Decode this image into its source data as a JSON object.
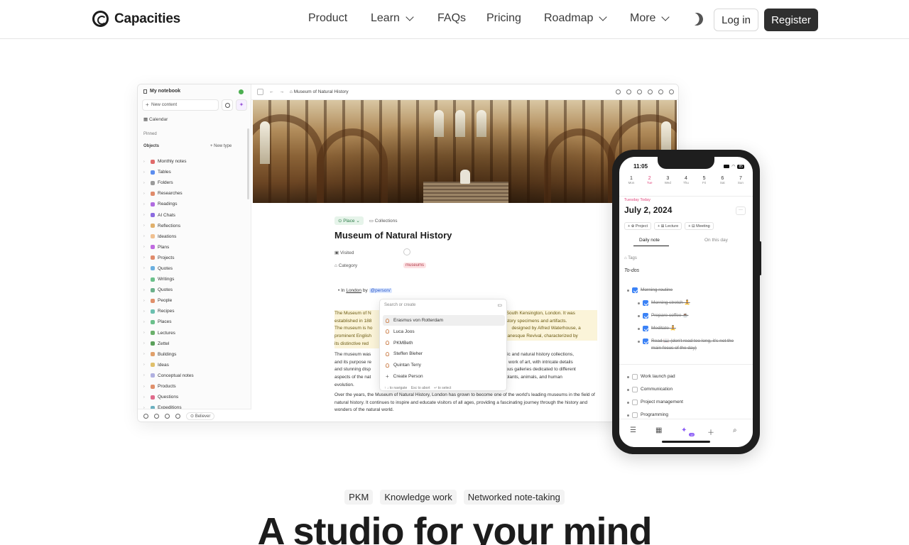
{
  "nav": {
    "brand": "Capacities",
    "items": [
      {
        "label": "Product",
        "dropdown": false
      },
      {
        "label": "Learn",
        "dropdown": true
      },
      {
        "label": "FAQs",
        "dropdown": false
      },
      {
        "label": "Pricing",
        "dropdown": false
      },
      {
        "label": "Roadmap",
        "dropdown": true
      },
      {
        "label": "More",
        "dropdown": true
      }
    ],
    "login": "Log in",
    "register": "Register"
  },
  "app": {
    "sidebar": {
      "notebook": "My notebook",
      "new_content": "New content",
      "calendar": "Calendar",
      "pinned": "Pinned",
      "objects": "Objects",
      "new_type": "New type",
      "items": [
        {
          "label": "Monthly notes",
          "color": "#e06b6b"
        },
        {
          "label": "Tables",
          "color": "#5b8def"
        },
        {
          "label": "Folders",
          "color": "#9a9a9a"
        },
        {
          "label": "Researches",
          "color": "#e08b6b"
        },
        {
          "label": "Readings",
          "color": "#b06be0"
        },
        {
          "label": "AI Chats",
          "color": "#8b6be0"
        },
        {
          "label": "Reflections",
          "color": "#e0b06b"
        },
        {
          "label": "Ideations",
          "color": "#f0c090"
        },
        {
          "label": "Plans",
          "color": "#c06be0"
        },
        {
          "label": "Projects",
          "color": "#e08b6b"
        },
        {
          "label": "Quotes",
          "color": "#6bb0e0"
        },
        {
          "label": "Writings",
          "color": "#6bc08b"
        },
        {
          "label": "Quotes",
          "color": "#6bb08b"
        },
        {
          "label": "People",
          "color": "#e0906b"
        },
        {
          "label": "Recipes",
          "color": "#6bc0b0"
        },
        {
          "label": "Places",
          "color": "#6bc08b"
        },
        {
          "label": "Lectures",
          "color": "#6bb06b"
        },
        {
          "label": "Zettel",
          "color": "#5ba05b"
        },
        {
          "label": "Buildings",
          "color": "#e0a06b"
        },
        {
          "label": "Ideas",
          "color": "#e0c06b"
        },
        {
          "label": "Conceptual notes",
          "color": "#b0b0e0"
        },
        {
          "label": "Products",
          "color": "#e0906b"
        },
        {
          "label": "Questions",
          "color": "#e06b8b"
        },
        {
          "label": "Expeditions",
          "color": "#6bb0c0"
        }
      ],
      "believer": "Believer"
    },
    "topbar_title": "Museum of Natural History",
    "object": {
      "type_tag": "Place",
      "collections": "Collections",
      "title": "Museum of Natural History",
      "visited_label": "Visited",
      "category_label": "Category",
      "category_value": "museums",
      "bullet_in": "In",
      "bullet_place": "London",
      "bullet_by": "by",
      "mention": "@person/",
      "para1_a": "The Museum of N",
      "para1_b": "South Kensington, London. It was",
      "para1_c": "established in 188",
      "para1_d": "history specimens and artifacts.",
      "para1_e": "The museum is ho",
      "para1_f": "designed by Alfred Waterhouse, a",
      "para1_g": "prominent English",
      "para1_h": "manesque Revival, characterized by",
      "para1_i": "its distinctive red",
      "para2_a": "The museum was",
      "para2_b": "fic and natural history collections,",
      "para2_c": "and its purpose re",
      "para2_d": "work of art, with intricate details",
      "para2_e": "and stunning disp",
      "para2_f": "ous galleries dedicated to different",
      "para2_g": "aspects of the nat",
      "para2_h": "olants, animals, and human",
      "para2_i": "evolution.",
      "para3": "Over the years, the Museum of Natural History, London has grown to become one of the world's leading museums in the field of natural history. It continues to inspire and educate visitors of all ages, providing a fascinating journey through the history and wonders of the natural world."
    },
    "popup": {
      "search": "Search or create",
      "items": [
        "Erasmus von Rotterdam",
        "Luca Joos",
        "PKMBeth",
        "Steffen Bleher",
        "Quintan Terry"
      ],
      "create": "Create Person",
      "hint_nav": "↑ ↓ to navigate",
      "hint_esc": "Esc to abort",
      "hint_sel": "↵ to select"
    }
  },
  "phone": {
    "time": "11:05",
    "battery": "85",
    "week": [
      {
        "n": "1",
        "d": "Mon"
      },
      {
        "n": "2",
        "d": "Tue",
        "active": true
      },
      {
        "n": "3",
        "d": "Wed"
      },
      {
        "n": "4",
        "d": "Thu"
      },
      {
        "n": "5",
        "d": "Fri"
      },
      {
        "n": "6",
        "d": "Sat"
      },
      {
        "n": "7",
        "d": "Sun"
      }
    ],
    "subtitle": "Tuesday  Today",
    "date": "July 2, 2024",
    "chips": [
      "Project",
      "Lecture",
      "Meeting"
    ],
    "tab_daily": "Daily note",
    "tab_onthisday": "On this day",
    "tags": "Tags",
    "todos_title": "To-dos",
    "todos_done": [
      "Morning routine",
      "Morning stretch 🧘",
      "Prepare coffee ☕",
      "Meditate 🧘",
      "Read 📖 (don't read too long, it's not the main focus of the day)"
    ],
    "todos_open": [
      "Work launch pad",
      "Communication",
      "Project management",
      "Programming"
    ],
    "nav_badge": "12"
  },
  "tags": [
    "PKM",
    "Knowledge work",
    "Networked note-taking"
  ],
  "headline": "A studio for your mind"
}
